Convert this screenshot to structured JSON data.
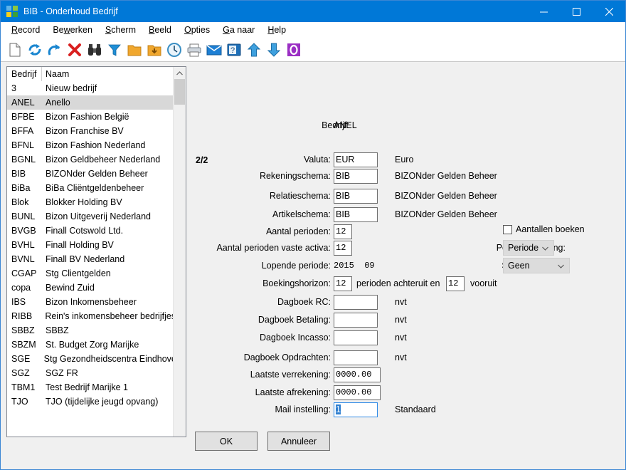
{
  "window": {
    "title": "BIB - Onderhoud Bedrijf",
    "icon": "app-logo-icon",
    "minimize_label": "Minimize",
    "maximize_label": "Maximize",
    "close_label": "Close"
  },
  "menubar": {
    "items": [
      {
        "label": "Record",
        "accel": "R"
      },
      {
        "label": "Bewerken",
        "accel": "w"
      },
      {
        "label": "Scherm",
        "accel": "S"
      },
      {
        "label": "Beeld",
        "accel": "B"
      },
      {
        "label": "Opties",
        "accel": "O"
      },
      {
        "label": "Ga naar",
        "accel": "G"
      },
      {
        "label": "Help",
        "accel": "H"
      }
    ]
  },
  "toolbar": {
    "icons": [
      "new-document-icon",
      "refresh-icon",
      "redo-icon",
      "delete-icon",
      "binoculars-search-icon",
      "filter-icon",
      "open-folder-icon",
      "save-folder-icon",
      "clock-history-icon",
      "print-icon",
      "mail-icon",
      "help-book-icon",
      "arrow-up-icon",
      "arrow-down-icon",
      "outlook-icon"
    ]
  },
  "list": {
    "columns": [
      "Bedrijf",
      "Naam"
    ],
    "selected_code": "ANEL",
    "rows": [
      {
        "code": "3",
        "name": "Nieuw bedrijf"
      },
      {
        "code": "ANEL",
        "name": "Anello"
      },
      {
        "code": "BFBE",
        "name": "Bizon Fashion België"
      },
      {
        "code": "BFFA",
        "name": "Bizon Franchise BV"
      },
      {
        "code": "BFNL",
        "name": "Bizon Fashion Nederland"
      },
      {
        "code": "BGNL",
        "name": "Bizon Geldbeheer Nederland"
      },
      {
        "code": "BIB",
        "name": "BIZONder Gelden Beheer"
      },
      {
        "code": "BiBa",
        "name": "BiBa Cliëntgeldenbeheer"
      },
      {
        "code": "Blok",
        "name": "Blokker Holding BV"
      },
      {
        "code": "BUNL",
        "name": "Bizon Uitgeverij Nederland"
      },
      {
        "code": "BVGB",
        "name": "Finall Cotswold Ltd."
      },
      {
        "code": "BVHL",
        "name": "Finall Holding BV"
      },
      {
        "code": "BVNL",
        "name": "Finall BV Nederland"
      },
      {
        "code": "CGAP",
        "name": "Stg Clientgelden"
      },
      {
        "code": "copa",
        "name": "Bewind Zuid"
      },
      {
        "code": "IBS",
        "name": "Bizon Inkomensbeheer"
      },
      {
        "code": "RIBB",
        "name": "Rein's inkomensbeheer bedrijfjes"
      },
      {
        "code": "SBBZ",
        "name": "SBBZ"
      },
      {
        "code": "SBZM",
        "name": "St. Budget Zorg Marijke"
      },
      {
        "code": "SGE",
        "name": "Stg Gezondheidscentra Eindhoven"
      },
      {
        "code": "SGZ",
        "name": "SGZ FR"
      },
      {
        "code": "TBM1",
        "name": "Test Bedrijf Marijke 1"
      },
      {
        "code": "TJO",
        "name": "TJO (tijdelijke jeugd opvang)"
      }
    ]
  },
  "form": {
    "bedrijf_label": "Bedrijf:",
    "bedrijf_value": "ANEL",
    "page_indicator": "2/2",
    "valuta": {
      "label": "Valuta:",
      "value": "EUR",
      "desc": "Euro"
    },
    "rekeningschema": {
      "label": "Rekeningschema:",
      "value": "BIB",
      "desc": "BIZONder Gelden Beheer"
    },
    "relatieschema": {
      "label": "Relatieschema:",
      "value": "BIB",
      "desc": "BIZONder Gelden Beheer"
    },
    "artikelschema": {
      "label": "Artikelschema:",
      "value": "BIB",
      "desc": "BIZONder Gelden Beheer"
    },
    "aantal_perioden": {
      "label": "Aantal perioden:",
      "value": "12"
    },
    "aantal_perioden_vaste_activa": {
      "label": "Aantal perioden vaste activa:",
      "value": "12"
    },
    "lopende_periode": {
      "label": "Lopende periode:",
      "value": "2015  09"
    },
    "boekingshorizon": {
      "label": "Boekingshorizon:",
      "value_back": "12",
      "middle_text": "perioden achteruit en",
      "value_forward": "12",
      "suffix_text": "vooruit"
    },
    "dagboek_rc": {
      "label": "Dagboek RC:",
      "value": "",
      "desc": "nvt"
    },
    "dagboek_betaling": {
      "label": "Dagboek Betaling:",
      "value": "",
      "desc": "nvt"
    },
    "dagboek_incasso": {
      "label": "Dagboek Incasso:",
      "value": "",
      "desc": "nvt"
    },
    "dagboek_opdrachten": {
      "label": "Dagboek Opdrachten:",
      "value": "",
      "desc": "nvt"
    },
    "laatste_verrekening": {
      "label": "Laatste verrekening:",
      "value": "0000.00"
    },
    "laatste_afrekening": {
      "label": "Laatste afrekening:",
      "value": "0000.00"
    },
    "mail_instelling": {
      "label": "Mail instelling:",
      "value": "1",
      "desc": "Standaard"
    },
    "aantallen_boeken": {
      "label": "Aantallen boeken",
      "checked": false
    },
    "periodeverdeling": {
      "label": "Periodeverdeling:",
      "value": "Periode"
    },
    "subcode_activa": {
      "label": "Subcode Activa:",
      "value": "Geen"
    }
  },
  "buttons": {
    "ok": "OK",
    "cancel": "Annuleer"
  },
  "colors": {
    "titlebar": "#0078d7",
    "selection": "#2f7fd0",
    "window_bg": "#f0f0f0"
  }
}
